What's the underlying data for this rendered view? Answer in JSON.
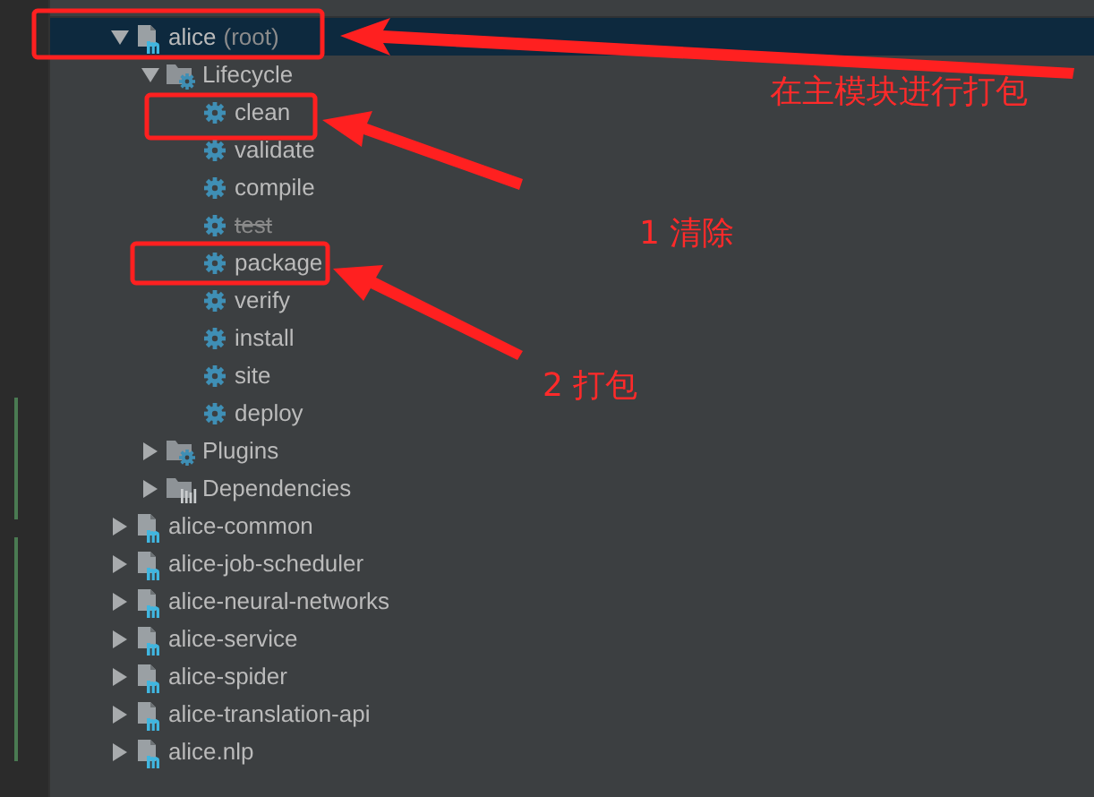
{
  "tree": [
    {
      "kind": "module",
      "label": "alice",
      "note": "(root)",
      "selected": true,
      "expanded": true,
      "children": [
        {
          "kind": "lifecycle",
          "label": "Lifecycle",
          "selected": false,
          "expanded": true,
          "children": [
            {
              "kind": "goal",
              "label": "clean",
              "selected": false,
              "skipped": false
            },
            {
              "kind": "goal",
              "label": "validate",
              "selected": false,
              "skipped": false
            },
            {
              "kind": "goal",
              "label": "compile",
              "selected": false,
              "skipped": false
            },
            {
              "kind": "goal",
              "label": "test",
              "selected": false,
              "skipped": true
            },
            {
              "kind": "goal",
              "label": "package",
              "selected": false,
              "skipped": false
            },
            {
              "kind": "goal",
              "label": "verify",
              "selected": false,
              "skipped": false
            },
            {
              "kind": "goal",
              "label": "install",
              "selected": false,
              "skipped": false
            },
            {
              "kind": "goal",
              "label": "site",
              "selected": false,
              "skipped": false
            },
            {
              "kind": "goal",
              "label": "deploy",
              "selected": false,
              "skipped": false
            }
          ]
        },
        {
          "kind": "plugins",
          "label": "Plugins",
          "selected": false,
          "expanded": false
        },
        {
          "kind": "dependencies",
          "label": "Dependencies",
          "selected": false,
          "expanded": false
        }
      ]
    },
    {
      "kind": "module",
      "label": "alice-common",
      "selected": false,
      "expanded": false
    },
    {
      "kind": "module",
      "label": "alice-job-scheduler",
      "selected": false,
      "expanded": false
    },
    {
      "kind": "module",
      "label": "alice-neural-networks",
      "selected": false,
      "expanded": false
    },
    {
      "kind": "module",
      "label": "alice-service",
      "selected": false,
      "expanded": false
    },
    {
      "kind": "module",
      "label": "alice-spider",
      "selected": false,
      "expanded": false
    },
    {
      "kind": "module",
      "label": "alice-translation-api",
      "selected": false,
      "expanded": false
    },
    {
      "kind": "module",
      "label": "alice.nlp",
      "selected": false,
      "expanded": false
    }
  ],
  "annotations": [
    {
      "text": "在主模块进行打包"
    },
    {
      "text": "1 清除"
    },
    {
      "text": "2 打包"
    }
  ]
}
